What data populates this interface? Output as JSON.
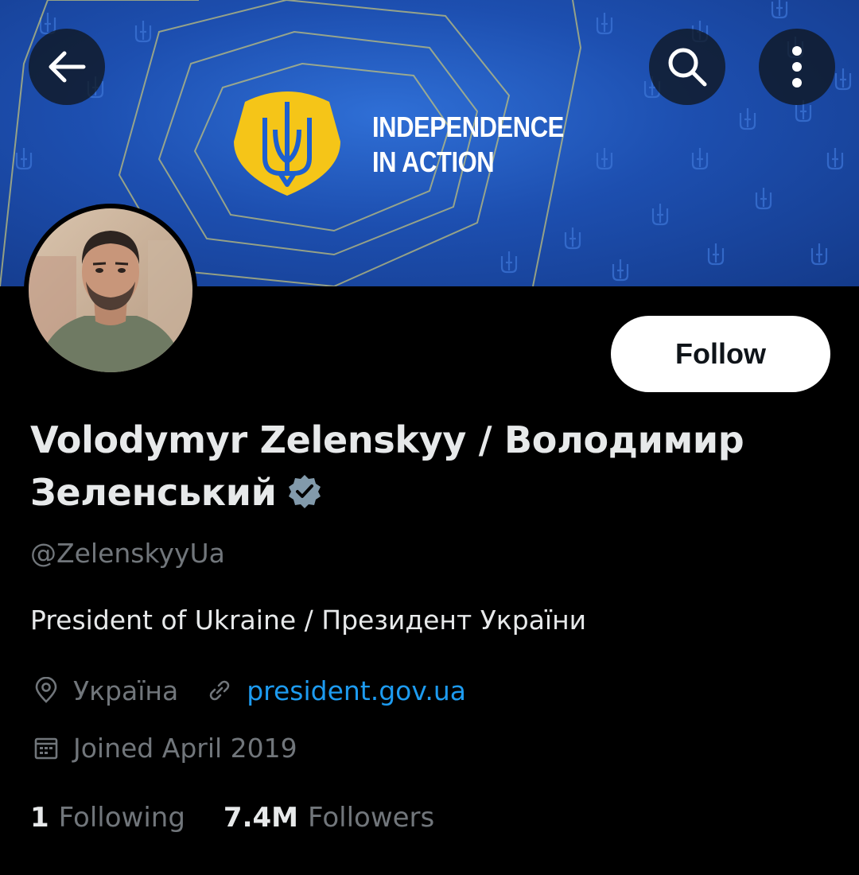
{
  "banner": {
    "line1": "INDEPENDENCE",
    "line2": "IN ACTION",
    "colors": {
      "blue": "#1d4fb0",
      "gold": "#f5c518",
      "trident": "#1d5fd0"
    }
  },
  "toolbar": {
    "back_icon": "arrow-left-icon",
    "search_icon": "search-icon",
    "more_icon": "more-vertical-icon"
  },
  "profile": {
    "name": "Volodymyr Zelenskyy / Володимир Зеленський",
    "handle": "@ZelenskyyUa",
    "bio": "President of Ukraine / Президент України",
    "location": "Україна",
    "website": "president.gov.ua",
    "joined": "Joined April 2019",
    "following_count": "1",
    "following_label": "Following",
    "followers_count": "7.4M",
    "followers_label": "Followers"
  },
  "actions": {
    "follow_label": "Follow"
  },
  "colors": {
    "background": "#000000",
    "text": "#e7e9ea",
    "muted": "#71767b",
    "link": "#1d9bf0",
    "verified": "#829aab"
  }
}
